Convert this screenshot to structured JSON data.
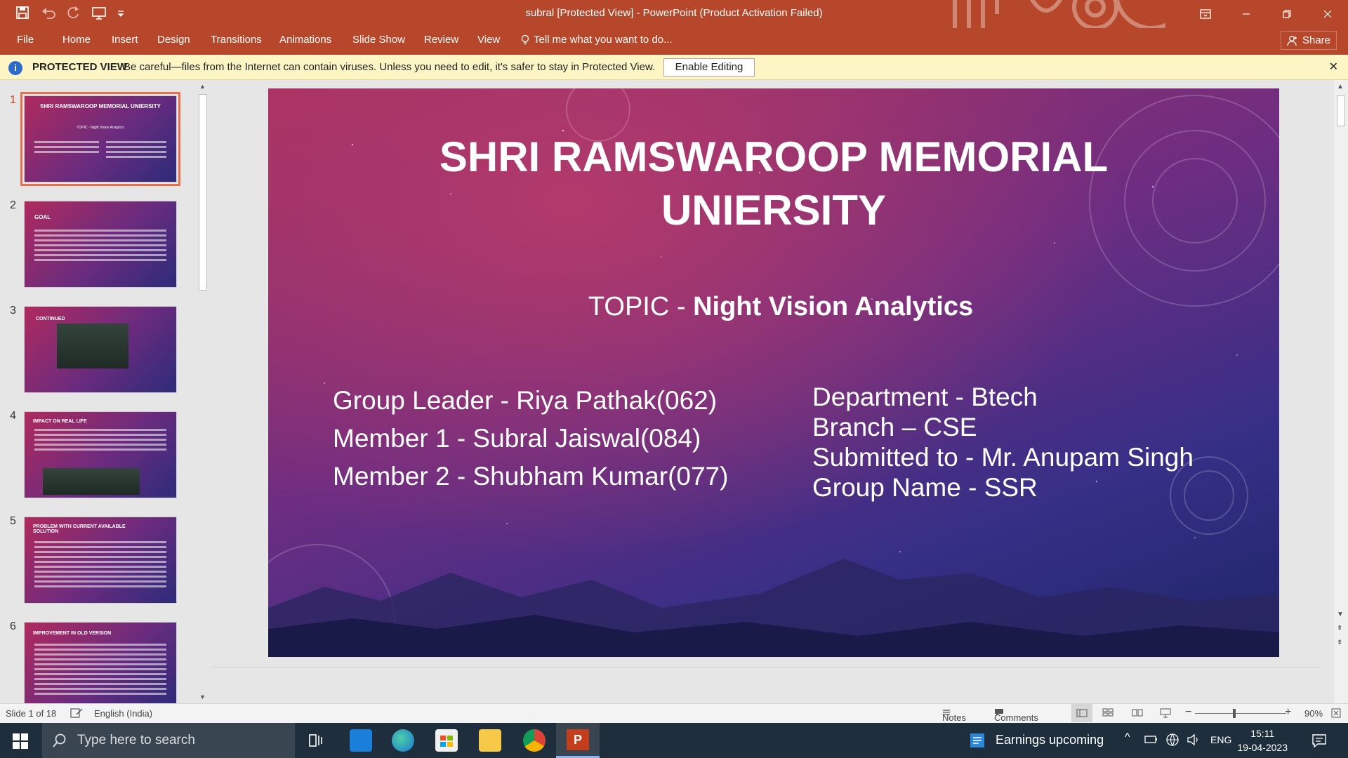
{
  "window": {
    "title": "subral [Protected View] - PowerPoint (Product Activation Failed)"
  },
  "ribbon": {
    "tabs": [
      "File",
      "Home",
      "Insert",
      "Design",
      "Transitions",
      "Animations",
      "Slide Show",
      "Review",
      "View"
    ],
    "tell_me": "Tell me what you want to do...",
    "share": "Share"
  },
  "protected_view": {
    "label": "PROTECTED VIEW",
    "message": "Be careful—files from the Internet can contain viruses. Unless you need to edit, it's safer to stay in Protected View.",
    "button": "Enable Editing"
  },
  "thumbnails": [
    {
      "num": "1",
      "title": "SHRI RAMSWAROOP MEMORIAL UNIERSITY",
      "sub": "TOPIC - Night Vision Analytics"
    },
    {
      "num": "2",
      "title": "GOAL"
    },
    {
      "num": "3",
      "title": "CONTINUED"
    },
    {
      "num": "4",
      "title": "IMPACT ON REAL LIFE"
    },
    {
      "num": "5",
      "title": "PROBLEM WITH CURRENT AVAILABLE SOLUTION"
    },
    {
      "num": "6",
      "title": "IMPROVEMENT IN OLD VERSION"
    }
  ],
  "slide": {
    "title_line1": "SHRI RAMSWAROOP MEMORIAL",
    "title_line2": "UNIERSITY",
    "topic_prefix": "TOPIC - ",
    "topic_bold": "Night Vision Analytics",
    "left": [
      "Group Leader - Riya Pathak(062)",
      "Member 1 - Subral Jaiswal(084)",
      "Member 2 - Shubham Kumar(077)"
    ],
    "right": [
      "Department - Btech",
      "Branch – CSE",
      "Submitted to - Mr. Anupam Singh",
      "Group Name - SSR"
    ]
  },
  "status": {
    "slide": "Slide 1 of 18",
    "language": "English (India)",
    "notes": "Notes",
    "comments": "Comments",
    "zoom": "90%"
  },
  "taskbar": {
    "search_placeholder": "Type here to search",
    "news": "Earnings upcoming",
    "lang": "ENG",
    "time": "15:11",
    "date": "19-04-2023"
  },
  "colors": {
    "accent": "#b7472a",
    "protected_bar": "#fdf6c4",
    "selection": "#e8704f"
  }
}
